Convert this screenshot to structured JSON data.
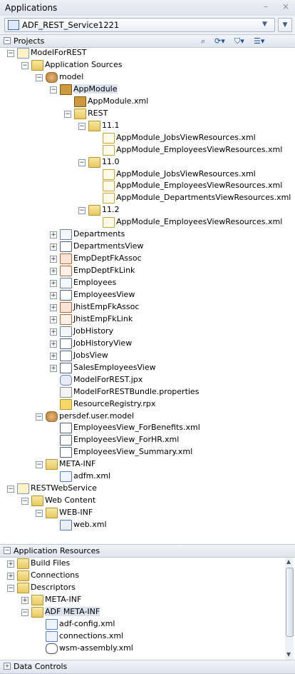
{
  "window": {
    "title": "Applications",
    "minimize_label": "–",
    "close_label": "×"
  },
  "application_selector": {
    "value": "ADF_REST_Service1221"
  },
  "projects_panel": {
    "title": "Projects"
  },
  "projects_tree": [
    {
      "label": "ModelForREST",
      "depth": 0,
      "icon": "project",
      "expander": "-"
    },
    {
      "label": "Application Sources",
      "depth": 1,
      "icon": "folder",
      "expander": "-"
    },
    {
      "label": "model",
      "depth": 2,
      "icon": "pkg",
      "expander": "-"
    },
    {
      "label": "AppModule",
      "depth": 3,
      "icon": "am",
      "expander": "-",
      "selected": true
    },
    {
      "label": "AppModule.xml",
      "depth": 4,
      "icon": "am",
      "expander": ""
    },
    {
      "label": "REST",
      "depth": 4,
      "icon": "folder",
      "expander": "-"
    },
    {
      "label": "11.1",
      "depth": 5,
      "icon": "folder",
      "expander": "-"
    },
    {
      "label": "AppModule_JobsViewResources.xml",
      "depth": 6,
      "icon": "xml",
      "expander": ""
    },
    {
      "label": "AppModule_EmployeesViewResources.xml",
      "depth": 6,
      "icon": "xml",
      "expander": ""
    },
    {
      "label": "11.0",
      "depth": 5,
      "icon": "folder",
      "expander": "-"
    },
    {
      "label": "AppModule_JobsViewResources.xml",
      "depth": 6,
      "icon": "xml",
      "expander": ""
    },
    {
      "label": "AppModule_EmployeesViewResources.xml",
      "depth": 6,
      "icon": "xml",
      "expander": ""
    },
    {
      "label": "AppModule_DepartmentsViewResources.xml",
      "depth": 6,
      "icon": "xml",
      "expander": ""
    },
    {
      "label": "11.2",
      "depth": 5,
      "icon": "folder",
      "expander": "-"
    },
    {
      "label": "AppModule_EmployeesViewResources.xml",
      "depth": 6,
      "icon": "xml",
      "expander": ""
    },
    {
      "label": "Departments",
      "depth": 3,
      "icon": "eo",
      "expander": "+"
    },
    {
      "label": "DepartmentsView",
      "depth": 3,
      "icon": "vo",
      "expander": "+"
    },
    {
      "label": "EmpDeptFkAssoc",
      "depth": 3,
      "icon": "assoc",
      "expander": "+"
    },
    {
      "label": "EmpDeptFkLink",
      "depth": 3,
      "icon": "link",
      "expander": "+"
    },
    {
      "label": "Employees",
      "depth": 3,
      "icon": "eo",
      "expander": "+"
    },
    {
      "label": "EmployeesView",
      "depth": 3,
      "icon": "vo",
      "expander": "+"
    },
    {
      "label": "JhistEmpFkAssoc",
      "depth": 3,
      "icon": "assoc",
      "expander": "+"
    },
    {
      "label": "JhistEmpFkLink",
      "depth": 3,
      "icon": "link",
      "expander": "+"
    },
    {
      "label": "JobHistory",
      "depth": 3,
      "icon": "eo",
      "expander": "+"
    },
    {
      "label": "JobHistoryView",
      "depth": 3,
      "icon": "vo",
      "expander": "+"
    },
    {
      "label": "JobsView",
      "depth": 3,
      "icon": "vo",
      "expander": "+"
    },
    {
      "label": "SalesEmployeesView",
      "depth": 3,
      "icon": "vo",
      "expander": "+"
    },
    {
      "label": "ModelForREST.jpx",
      "depth": 3,
      "icon": "jpx",
      "expander": ""
    },
    {
      "label": "ModelForRESTBundle.properties",
      "depth": 3,
      "icon": "props",
      "expander": ""
    },
    {
      "label": "ResourceRegistry.rpx",
      "depth": 3,
      "icon": "rpx",
      "expander": ""
    },
    {
      "label": "persdef.user.model",
      "depth": 2,
      "icon": "pkg",
      "expander": "-"
    },
    {
      "label": "EmployeesView_ForBenefits.xml",
      "depth": 3,
      "icon": "vo",
      "expander": ""
    },
    {
      "label": "EmployeesView_ForHR.xml",
      "depth": 3,
      "icon": "vo",
      "expander": ""
    },
    {
      "label": "EmployeesView_Summary.xml",
      "depth": 3,
      "icon": "vo",
      "expander": ""
    },
    {
      "label": "META-INF",
      "depth": 2,
      "icon": "folder",
      "expander": "-"
    },
    {
      "label": "adfm.xml",
      "depth": 3,
      "icon": "xmlf",
      "expander": ""
    },
    {
      "label": "RESTWebService",
      "depth": 0,
      "icon": "project",
      "expander": "-"
    },
    {
      "label": "Web Content",
      "depth": 1,
      "icon": "folder",
      "expander": "-"
    },
    {
      "label": "WEB-INF",
      "depth": 2,
      "icon": "folder",
      "expander": "-"
    },
    {
      "label": "web.xml",
      "depth": 3,
      "icon": "ws",
      "expander": ""
    }
  ],
  "resources_panel": {
    "title": "Application Resources"
  },
  "resources_tree": [
    {
      "label": "Build Files",
      "depth": 0,
      "icon": "folder",
      "expander": "+"
    },
    {
      "label": "Connections",
      "depth": 0,
      "icon": "folder",
      "expander": "+"
    },
    {
      "label": "Descriptors",
      "depth": 0,
      "icon": "folder",
      "expander": "-"
    },
    {
      "label": "META-INF",
      "depth": 1,
      "icon": "folder",
      "expander": "+"
    },
    {
      "label": "ADF META-INF",
      "depth": 1,
      "icon": "folder",
      "expander": "-",
      "selected": true
    },
    {
      "label": "adf-config.xml",
      "depth": 2,
      "icon": "xmlf",
      "expander": ""
    },
    {
      "label": "connections.xml",
      "depth": 2,
      "icon": "xmlf",
      "expander": ""
    },
    {
      "label": "wsm-assembly.xml",
      "depth": 2,
      "icon": "wsm",
      "expander": ""
    }
  ],
  "data_controls_panel": {
    "title": "Data Controls"
  },
  "toolbar_icons": [
    "search-icon",
    "sync-icon",
    "filter-icon",
    "options-icon"
  ]
}
